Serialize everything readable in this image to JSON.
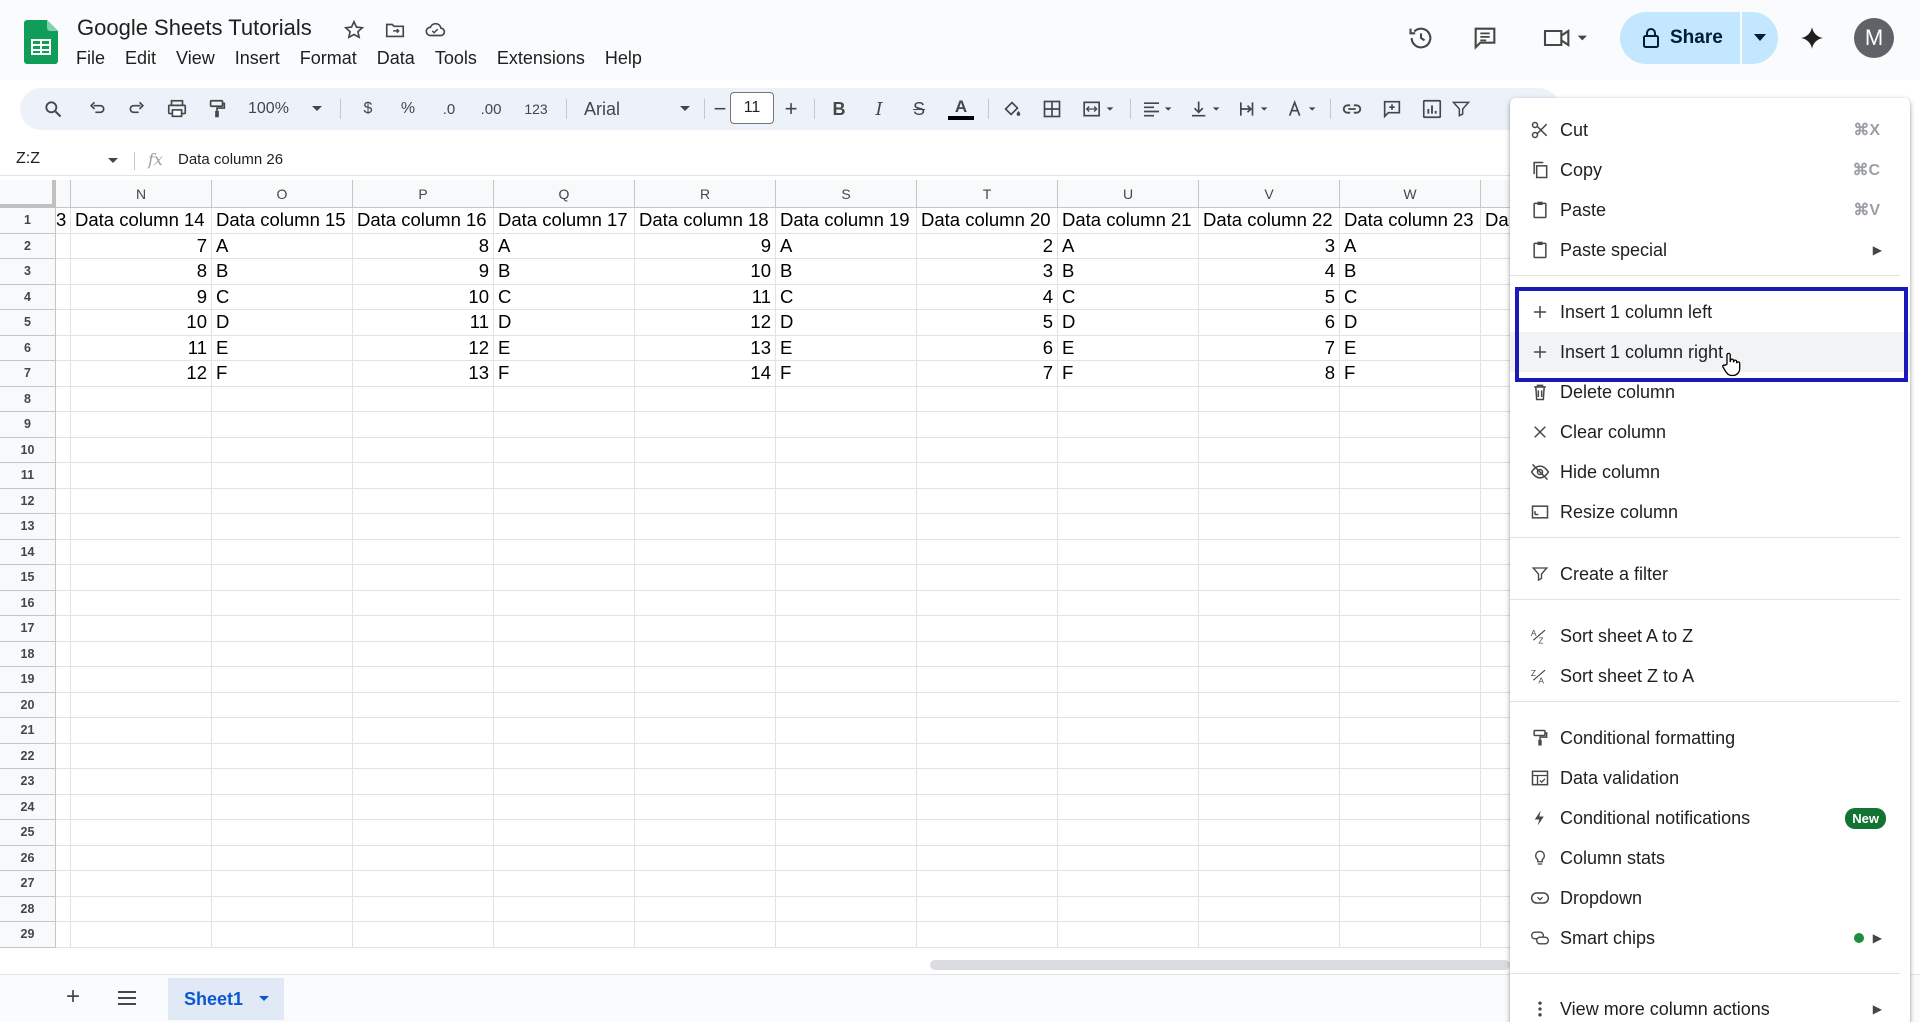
{
  "header": {
    "doc_title": "Google Sheets Tutorials",
    "menu": [
      "File",
      "Edit",
      "View",
      "Insert",
      "Format",
      "Data",
      "Tools",
      "Extensions",
      "Help"
    ],
    "share_label": "Share",
    "avatar_letter": "M"
  },
  "toolbar": {
    "zoom": "100%",
    "currency": "$",
    "percent": "%",
    "dec_decrease": ".0",
    "dec_increase": ".00",
    "format_number": "123",
    "font": "Arial",
    "font_size": "11",
    "minus": "−",
    "plus": "+",
    "bold": "B",
    "italic": "I",
    "strike": "S",
    "text_color": "A"
  },
  "formula_bar": {
    "name_box": "Z:Z",
    "fx": "fx",
    "content": "Data column 26"
  },
  "grid": {
    "partial_col_text": "3",
    "partial_right_text": "Da",
    "columns": [
      "N",
      "O",
      "P",
      "Q",
      "R",
      "S",
      "T",
      "U",
      "V",
      "W"
    ],
    "rows": [
      "1",
      "2",
      "3",
      "4",
      "5",
      "6",
      "7",
      "8",
      "9",
      "10",
      "11",
      "12",
      "13",
      "14",
      "15",
      "16",
      "17",
      "18",
      "19",
      "20",
      "21",
      "22",
      "23",
      "24",
      "25",
      "26",
      "27",
      "28",
      "29"
    ],
    "header_row": [
      "Data column 14",
      "Data column 15",
      "Data column 16",
      "Data column 17",
      "Data column 18",
      "Data column 19",
      "Data column 20",
      "Data column 21",
      "Data column 22",
      "Data column 23"
    ],
    "data": [
      [
        "7",
        "A",
        "8",
        "A",
        "9",
        "A",
        "2",
        "A",
        "3",
        "A"
      ],
      [
        "8",
        "B",
        "9",
        "B",
        "10",
        "B",
        "3",
        "B",
        "4",
        "B"
      ],
      [
        "9",
        "C",
        "10",
        "C",
        "11",
        "C",
        "4",
        "C",
        "5",
        "C"
      ],
      [
        "10",
        "D",
        "11",
        "D",
        "12",
        "D",
        "5",
        "D",
        "6",
        "D"
      ],
      [
        "11",
        "E",
        "12",
        "E",
        "13",
        "E",
        "6",
        "E",
        "7",
        "E"
      ],
      [
        "12",
        "F",
        "13",
        "F",
        "14",
        "F",
        "7",
        "F",
        "8",
        "F"
      ]
    ]
  },
  "sheets": {
    "add": "+",
    "active": "Sheet1"
  },
  "context_menu": {
    "items": [
      {
        "label": "Cut",
        "shortcut": "⌘X",
        "icon": "scissors-icon"
      },
      {
        "label": "Copy",
        "shortcut": "⌘C",
        "icon": "copy-icon"
      },
      {
        "label": "Paste",
        "shortcut": "⌘V",
        "icon": "clipboard-icon"
      },
      {
        "label": "Paste special",
        "icon": "clipboard-icon"
      },
      {
        "label": "Insert 1 column left",
        "icon": "plus-icon"
      },
      {
        "label": "Insert 1 column right",
        "icon": "plus-icon"
      },
      {
        "label": "Delete column",
        "icon": "trash-icon"
      },
      {
        "label": "Clear column",
        "icon": "close-icon"
      },
      {
        "label": "Hide column",
        "icon": "eye-off-icon"
      },
      {
        "label": "Resize column",
        "icon": "resize-icon"
      },
      {
        "label": "Create a filter",
        "icon": "filter-icon"
      },
      {
        "label": "Sort sheet A to Z",
        "icon": "sort-az-icon"
      },
      {
        "label": "Sort sheet Z to A",
        "icon": "sort-za-icon"
      },
      {
        "label": "Conditional formatting",
        "icon": "paint-format-icon"
      },
      {
        "label": "Data validation",
        "icon": "data-validation-icon"
      },
      {
        "label": "Conditional notifications",
        "icon": "bolt-icon",
        "badge": "New"
      },
      {
        "label": "Column stats",
        "icon": "lightbulb-icon"
      },
      {
        "label": "Dropdown",
        "icon": "dropdown-icon"
      },
      {
        "label": "Smart chips",
        "icon": "smart-chips-icon"
      },
      {
        "label": "View more column actions",
        "icon": "more-vert-icon"
      }
    ]
  },
  "colors": {
    "accent": "#0b57d0",
    "share_bg": "#c2e7ff",
    "highlight_box": "#1a1ab8",
    "new_badge": "#137333"
  }
}
